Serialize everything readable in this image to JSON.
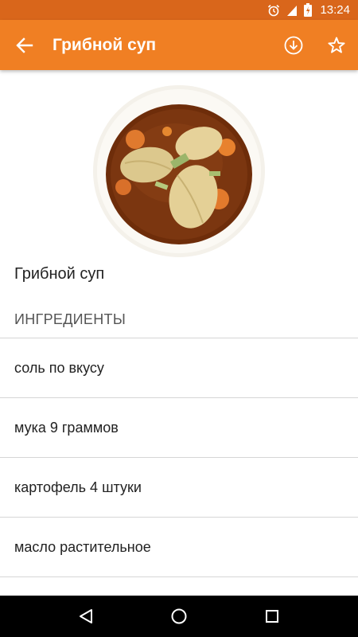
{
  "status_bar": {
    "time": "13:24",
    "icons": [
      "alarm-icon",
      "signal-icon",
      "battery-icon"
    ],
    "background": "#d9661b"
  },
  "app_bar": {
    "title": "Грибной суп",
    "back_icon": "arrow-back-icon",
    "actions": [
      "download-icon",
      "star-icon"
    ],
    "background": "#f07f23"
  },
  "recipe": {
    "title": "Грибной суп",
    "ingredients_header": "ИНГРЕДИЕНТЫ",
    "ingredients": [
      "соль по вкусу",
      "мука 9 граммов",
      "картофель 4 штуки",
      "масло растительное"
    ]
  },
  "nav_bar": {
    "buttons": [
      "back-triangle-icon",
      "home-circle-icon",
      "recents-square-icon"
    ]
  }
}
